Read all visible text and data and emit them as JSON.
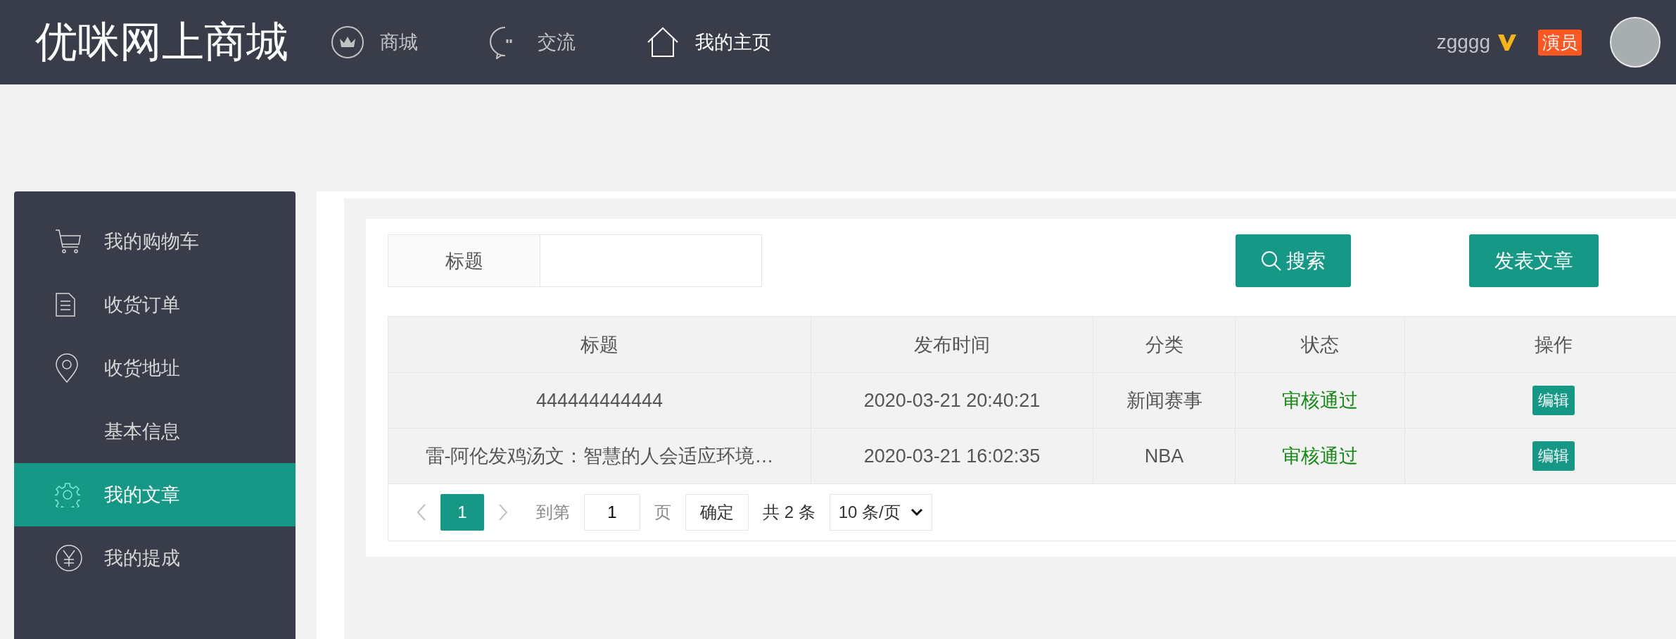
{
  "header": {
    "logo": "优咪网上商城",
    "nav": [
      {
        "label": "商城",
        "selected": false
      },
      {
        "label": "交流",
        "selected": false
      },
      {
        "label": "我的主页",
        "selected": true
      }
    ],
    "user": {
      "name": "zgggg",
      "role_badge": "演员"
    }
  },
  "sidebar": {
    "items": [
      {
        "label": "我的购物车",
        "selected": false
      },
      {
        "label": "收货订单",
        "selected": false
      },
      {
        "label": "收货地址",
        "selected": false
      },
      {
        "label": "基本信息",
        "selected": false
      },
      {
        "label": "我的文章",
        "selected": true
      },
      {
        "label": "我的提成",
        "selected": false
      }
    ]
  },
  "search": {
    "label": "标题",
    "search_button": "搜索",
    "publish_button": "发表文章"
  },
  "table": {
    "columns": [
      "标题",
      "发布时间",
      "分类",
      "状态",
      "操作"
    ],
    "rows": [
      {
        "title": "444444444444",
        "time": "2020-03-21 20:40:21",
        "category": "新闻赛事",
        "status": "审核通过",
        "action": "编辑"
      },
      {
        "title": "雷-阿伦发鸡汤文：智慧的人会适应环境…",
        "time": "2020-03-21 16:02:35",
        "category": "NBA",
        "status": "审核通过",
        "action": "编辑"
      }
    ]
  },
  "pagination": {
    "pages": [
      {
        "label": "1",
        "selected": true
      }
    ],
    "goto_label": "到第",
    "goto_value": "1",
    "page_unit": "页",
    "confirm": "确定",
    "total": "共 2 条",
    "page_size": "10 条/页"
  }
}
